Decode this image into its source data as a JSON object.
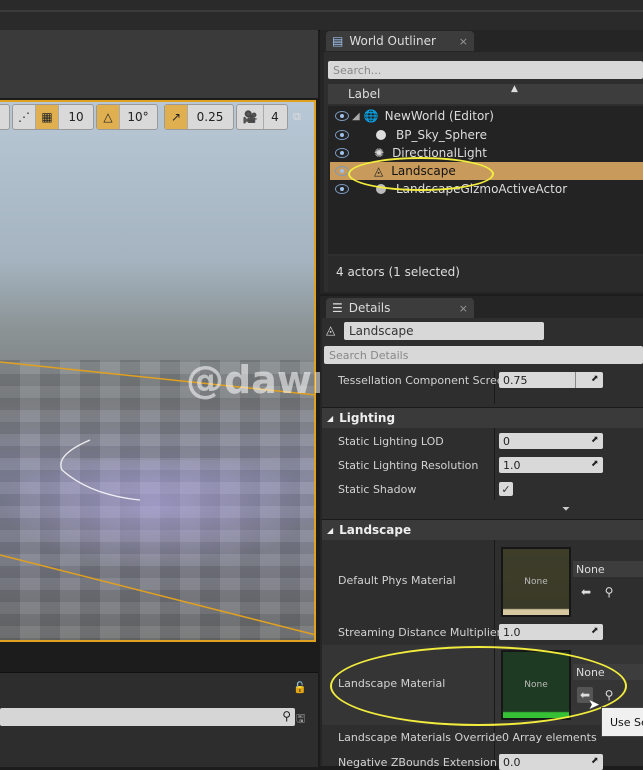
{
  "viewport_toolbar": {
    "grid_snap_value": "10",
    "rotation_snap_value": "10°",
    "scale_snap_value": "0.25",
    "camera_speed_value": "4"
  },
  "world_outliner": {
    "tab_label": "World Outliner",
    "close_glyph": "×",
    "search_placeholder": "Search...",
    "column_label": "Label",
    "rows": [
      {
        "label": "NewWorld (Editor)",
        "icon": "world-icon"
      },
      {
        "label": "BP_Sky_Sphere",
        "icon": "sphere-icon"
      },
      {
        "label": "DirectionalLight",
        "icon": "light-icon"
      },
      {
        "label": "Landscape",
        "icon": "landscape-icon",
        "selected": true
      },
      {
        "label": "LandscapeGizmoActiveActor",
        "icon": "sphere-icon"
      }
    ],
    "status": "4 actors (1 selected)"
  },
  "details": {
    "tab_label": "Details",
    "close_glyph": "×",
    "object_name": "Landscape",
    "search_placeholder": "Search Details",
    "tessellation_label": "Tessellation Component Screen",
    "tessellation_value": "0.75",
    "lighting_header": "Lighting",
    "static_lighting_lod_label": "Static Lighting LOD",
    "static_lighting_lod_value": "0",
    "static_lighting_res_label": "Static Lighting Resolution",
    "static_lighting_res_value": "1.0",
    "static_shadow_label": "Static Shadow",
    "static_shadow_checked": "✓",
    "landscape_header": "Landscape",
    "default_phys_label": "Default Phys Material",
    "default_phys_thumb": "None",
    "default_phys_value": "None",
    "streaming_label": "Streaming Distance Multiplier",
    "streaming_value": "1.0",
    "landscape_material_label": "Landscape Material",
    "landscape_material_thumb": "None",
    "landscape_material_value": "None",
    "override_label": "Landscape Materials Override",
    "override_value": "0 Array elements",
    "neg_z_label": "Negative ZBounds Extension",
    "neg_z_value": "0.0"
  },
  "watermark": "@dawn_arc",
  "tooltip": "Use Se",
  "colors": {
    "selection": "#c89b5d",
    "highlight_ellipse": "#f2ec3d",
    "viewport_border": "#e0a020"
  }
}
